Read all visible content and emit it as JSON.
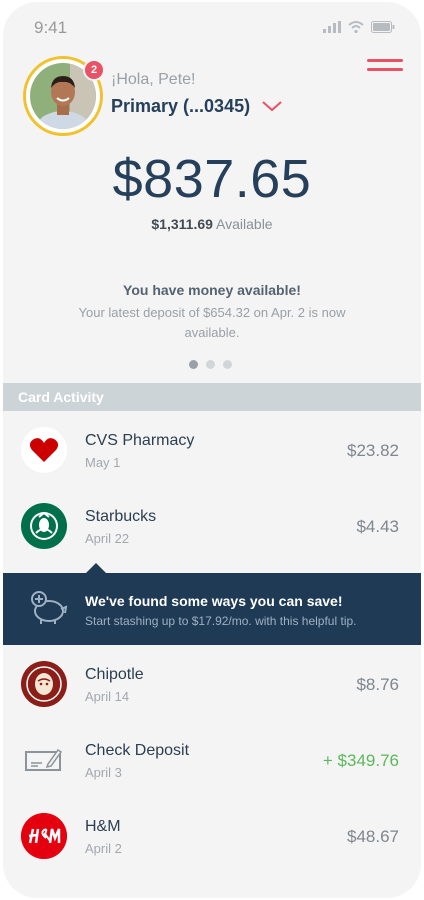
{
  "status_bar": {
    "time": "9:41"
  },
  "header": {
    "badge_count": "2",
    "greeting": "¡Hola, Pete!",
    "account": "Primary (...0345)"
  },
  "balance": {
    "amount": "$837.65",
    "available_amount": "$1,311.69",
    "available_label": "Available"
  },
  "promo": {
    "title": "You have money available!",
    "text": "Your latest deposit of $654.32 on Apr. 2 is now available.",
    "pages": 3,
    "active_page": 1
  },
  "section_title": "Card Activity",
  "transactions": [
    {
      "merchant": "CVS Pharmacy",
      "date": "May 1",
      "amount": "$23.82",
      "icon": "heart-icon"
    },
    {
      "merchant": "Starbucks",
      "date": "April 22",
      "amount": "$4.43",
      "icon": "starbucks-logo"
    },
    {
      "merchant": "Chipotle",
      "date": "April 14",
      "amount": "$8.76",
      "icon": "chipotle-logo"
    },
    {
      "merchant": "Check Deposit",
      "date": "April 3",
      "amount": "+ $349.76",
      "icon": "check-icon"
    },
    {
      "merchant": "H&M",
      "date": "April 2",
      "amount": "$48.67",
      "icon": "hm-logo"
    }
  ],
  "tip_banner": {
    "title": "We've found some ways you can save!",
    "text": "Start stashing up to $17.92/mo. with this helpful tip."
  },
  "colors": {
    "accent": "#e85166",
    "navy": "#26405b",
    "banner": "#1f3a55",
    "positive": "#5cb85c"
  }
}
